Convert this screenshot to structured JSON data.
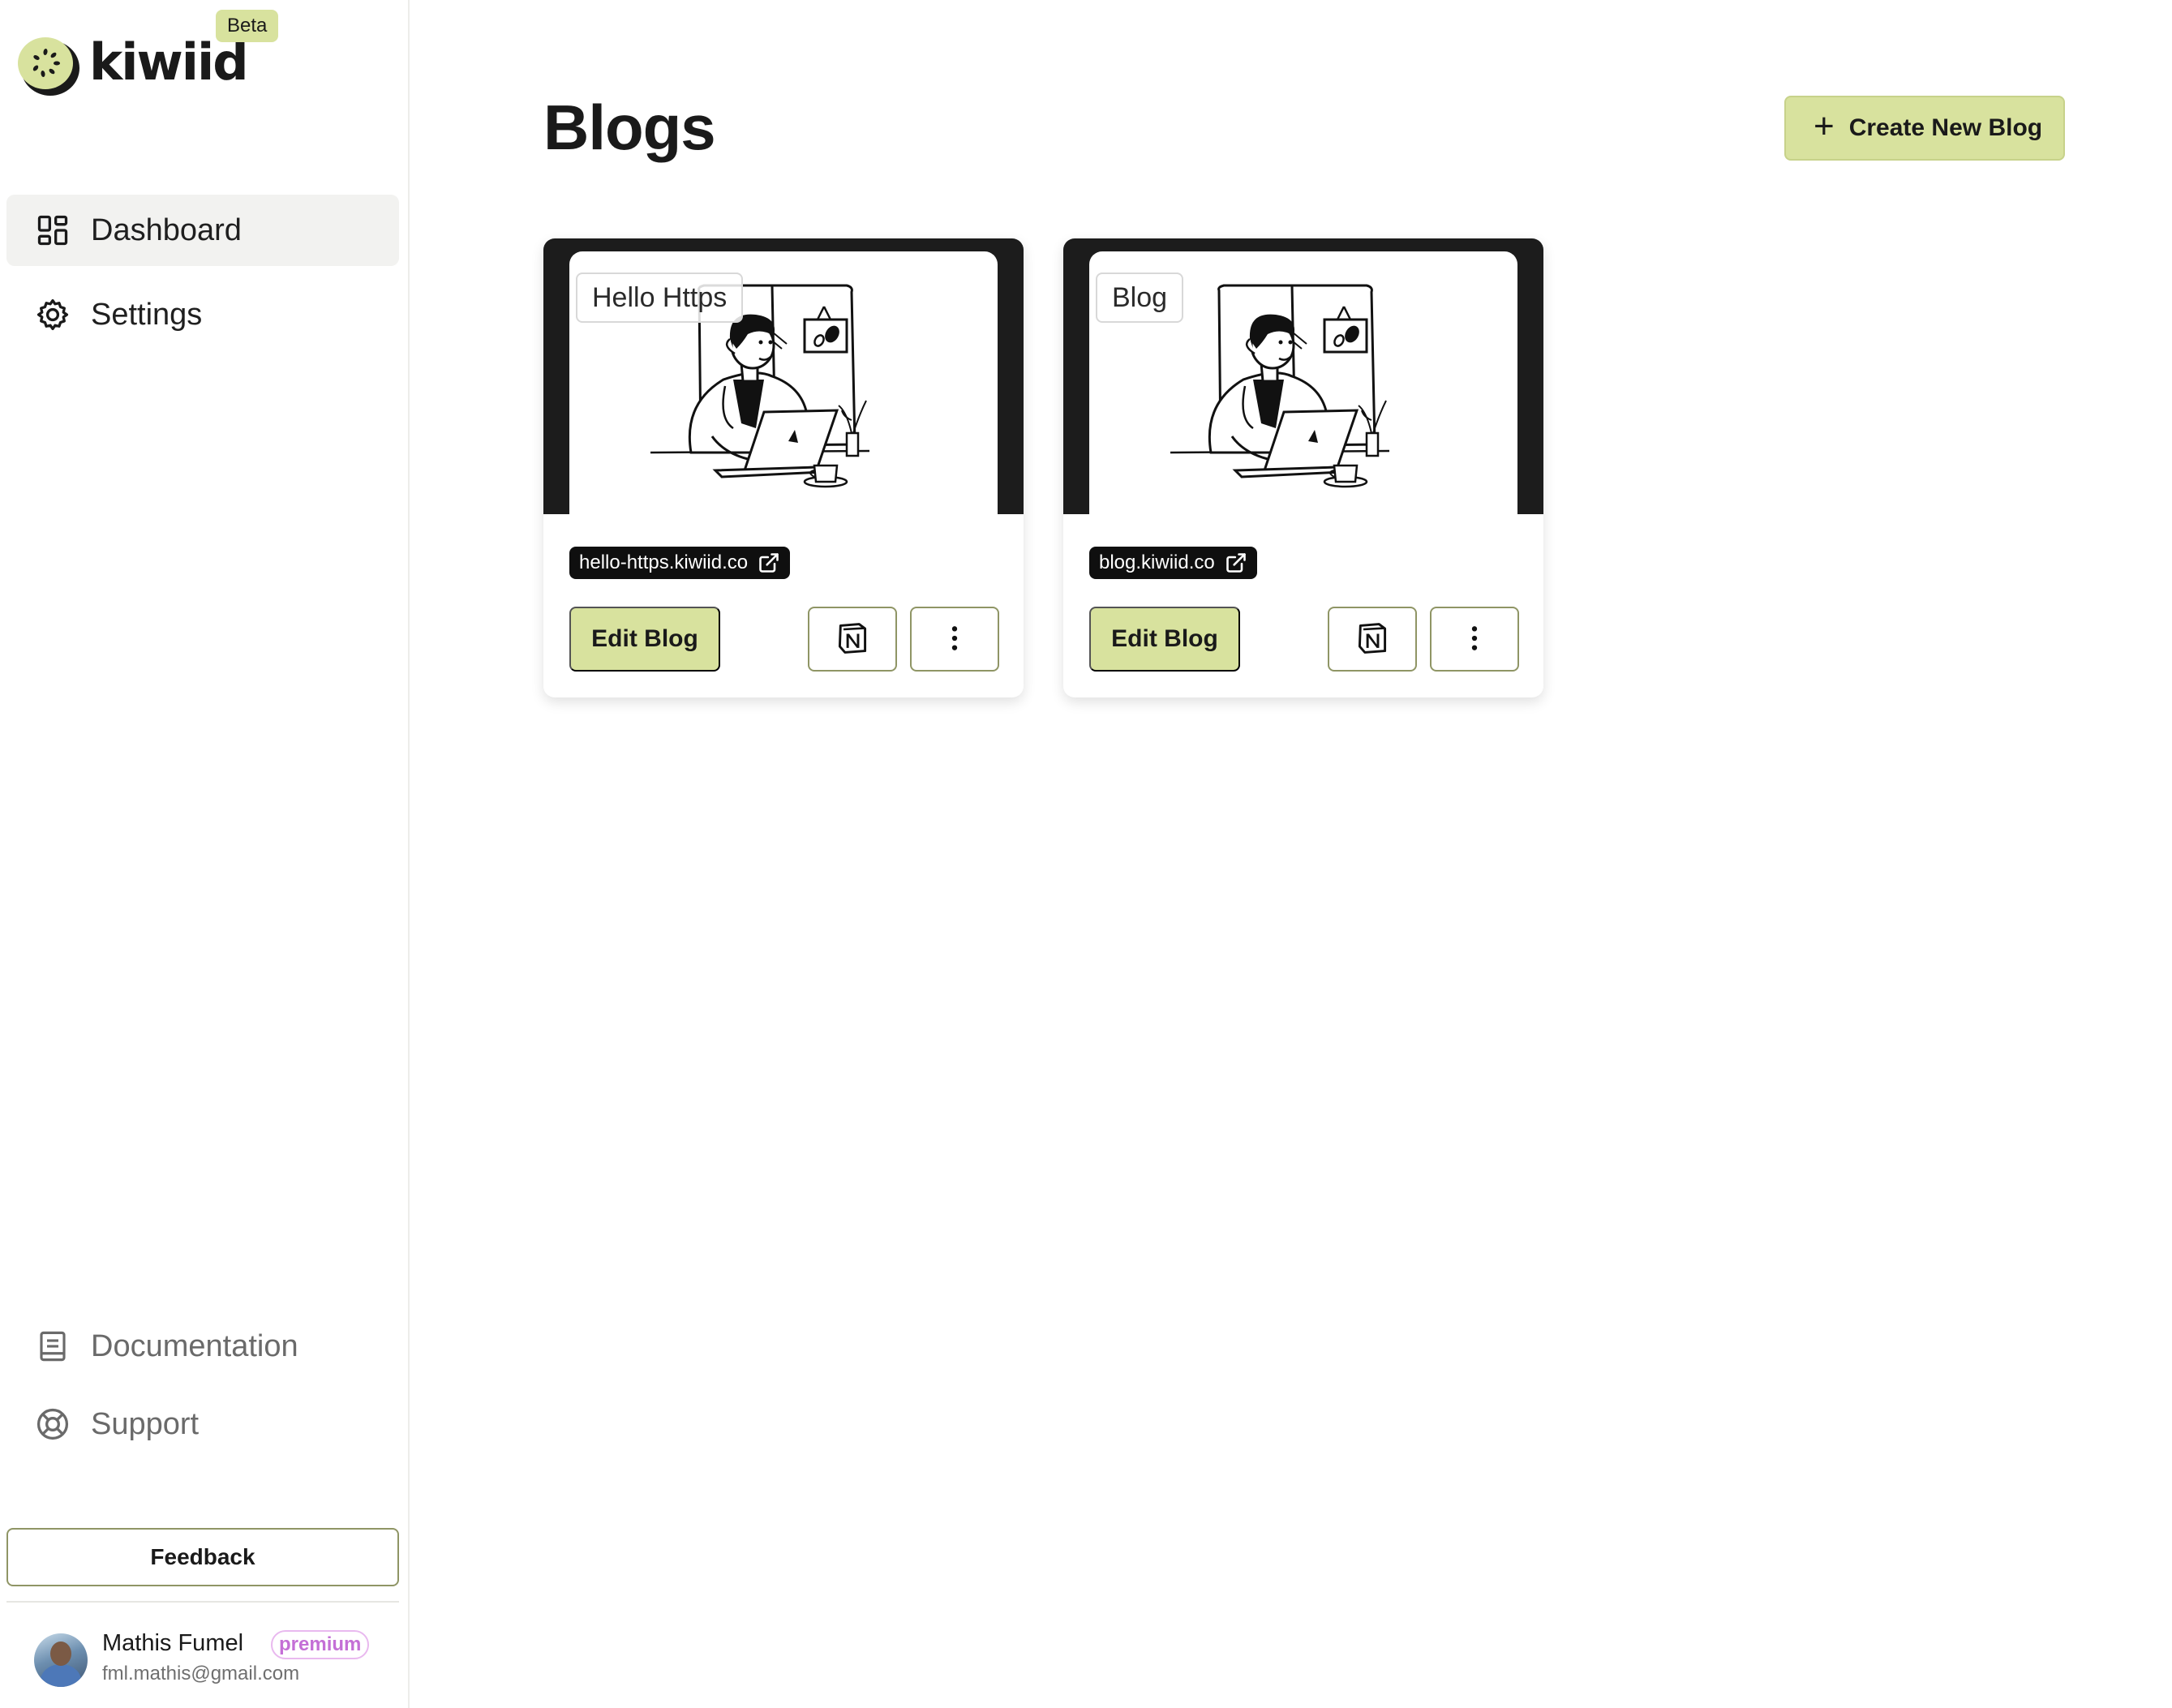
{
  "brand": {
    "name": "kiwiid",
    "badge": "Beta"
  },
  "sidebar": {
    "nav": [
      {
        "label": "Dashboard",
        "icon": "dashboard-icon",
        "active": true
      },
      {
        "label": "Settings",
        "icon": "gear-icon",
        "active": false
      }
    ],
    "bottom_nav": [
      {
        "label": "Documentation",
        "icon": "book-icon"
      },
      {
        "label": "Support",
        "icon": "lifebuoy-icon"
      }
    ],
    "feedback_label": "Feedback",
    "user": {
      "name": "Mathis Fumel",
      "plan": "premium",
      "email": "fml.mathis@gmail.com"
    }
  },
  "main": {
    "title": "Blogs",
    "create_label": "Create New Blog",
    "blogs": [
      {
        "name": "Hello Https",
        "url": "hello-https.kiwiid.co",
        "edit_label": "Edit Blog"
      },
      {
        "name": "Blog",
        "url": "blog.kiwiid.co",
        "edit_label": "Edit Blog"
      }
    ]
  },
  "colors": {
    "accent": "#d8e29e",
    "accent_border": "#8f9565",
    "premium": "#c46fd6",
    "dark": "#1c1c1c"
  }
}
